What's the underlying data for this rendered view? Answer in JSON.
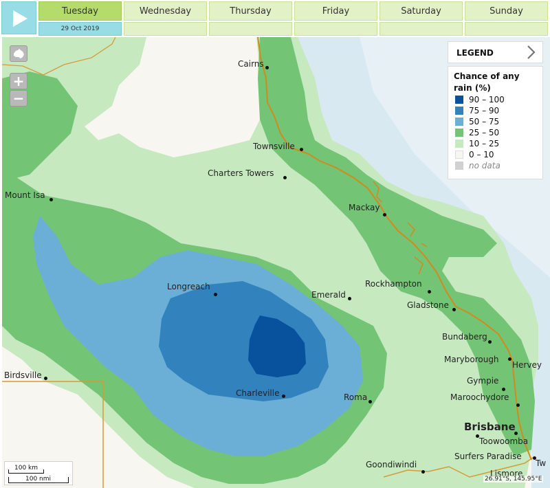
{
  "toolbar": {
    "days": [
      "Tuesday",
      "Wednesday",
      "Thursday",
      "Friday",
      "Saturday",
      "Sunday"
    ],
    "active_day": "Tuesday",
    "active_date": "29 Oct 2019"
  },
  "legend": {
    "header": "LEGEND",
    "title": "Chance of any rain (%)",
    "items": [
      {
        "label": "90 – 100",
        "color": "#08519c"
      },
      {
        "label": "75 – 90",
        "color": "#3182bd"
      },
      {
        "label": "50 – 75",
        "color": "#6baed6"
      },
      {
        "label": "25 – 50",
        "color": "#74c476"
      },
      {
        "label": "10 – 25",
        "color": "#c7e9c0"
      },
      {
        "label": "0 – 10",
        "color": "#f7f6f0"
      },
      {
        "label": "no data",
        "color": "#d0d0d0"
      }
    ]
  },
  "towns": {
    "cairns": "Cairns",
    "townsville": "Townsville",
    "charters_towers": "Charters Towers",
    "mount_isa": "Mount Isa",
    "mackay": "Mackay",
    "rockhampton": "Rockhampton",
    "emerald": "Emerald",
    "gladstone": "Gladstone",
    "longreach": "Longreach",
    "bundaberg": "Bundaberg",
    "maryborough": "Maryborough",
    "hervey": "Hervey",
    "birdsville": "Birdsville",
    "gympie": "Gympie",
    "charleville": "Charleville",
    "roma": "Roma",
    "maroochydore": "Maroochydore",
    "brisbane": "Brisbane",
    "toowoomba": "Toowoomba",
    "surfers_paradise": "Surfers Paradise",
    "tw": "Tw",
    "goondiwindi": "Goondiwindi",
    "lismore": "Lismore"
  },
  "scale": {
    "km": "100 km",
    "nmi": "100 nmi"
  },
  "coordinates": "26.91°S, 145.95°E",
  "icons": {
    "play": "play-icon",
    "home": "australia-home-icon",
    "zoom_in": "zoom-in-icon",
    "zoom_out": "zoom-out-icon",
    "legend_toggle": "chevron-right-icon"
  }
}
